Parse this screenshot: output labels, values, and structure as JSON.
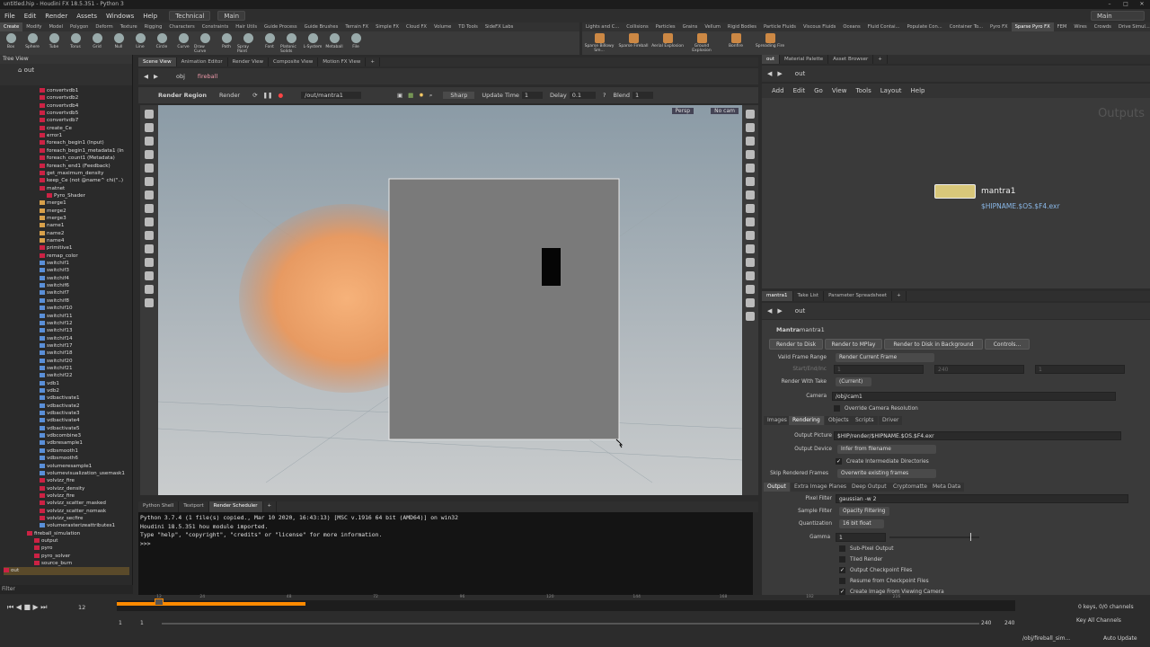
{
  "window": {
    "title": "untitled.hip - Houdini FX 18.5.351 - Python 3"
  },
  "menu": [
    "File",
    "Edit",
    "Render",
    "Assets",
    "Windows",
    "Help"
  ],
  "desktop": {
    "technical": "Technical",
    "main": "Main",
    "right_main": "Main"
  },
  "shelf_tabs": [
    "Create",
    "Modify",
    "Model",
    "Polygon",
    "Deform",
    "Texture",
    "Rigging",
    "Characters",
    "Constraints",
    "Hair Utils",
    "Guide Process",
    "Guide Brushes",
    "Terrain FX",
    "Simple FX",
    "Cloud FX",
    "Volume",
    "TD Tools",
    "SideFX Labs"
  ],
  "shelf_tools": [
    "Box",
    "Sphere",
    "Tube",
    "Torus",
    "Grid",
    "Null",
    "Line",
    "Circle",
    "Curve",
    "Draw Curve",
    "Path",
    "Spray Paint",
    "Font",
    "Platonic Solids",
    "L-System",
    "Metaball",
    "File"
  ],
  "shelf_tabs_right": [
    "Lights and C...",
    "Collisions",
    "Particles",
    "Grains",
    "Vellum",
    "Rigid Bodies",
    "Particle Fluids",
    "Viscous Fluids",
    "Oceans",
    "Fluid Contai...",
    "Populate Con...",
    "Container To...",
    "Pyro FX",
    "Sparse Pyro FX",
    "FEM",
    "Wires",
    "Crowds",
    "Drive Simul..."
  ],
  "shelf_tools_right": [
    "Sparse Billowy Sm...",
    "Sparse Fireball",
    "Aerial Explosion",
    "Ground Explosion",
    "Bonfire",
    "Spreading Fire"
  ],
  "tree": {
    "header": "Tree View",
    "path": "out",
    "filter": "Filter",
    "nodes": [
      "convertvdb1",
      "convertvdb2",
      "convertvdb4",
      "convertvdb5",
      "convertvdb7",
      "create_Ce",
      "error1",
      "foreach_begin1 (Input)",
      "foreach_begin1_metadata1 (In",
      "foreach_count1 (Metadata)",
      "foreach_end1 (Feedback)",
      "get_maximum_density",
      "keep_Ce (not @name^ chi(\"..)",
      "matnet",
      "Pyro_Shader",
      "merge1",
      "merge2",
      "merge3",
      "name1",
      "name2",
      "name4",
      "primitive1",
      "remap_color",
      "switchif1",
      "switchif3",
      "switchif4",
      "switchif6",
      "switchif7",
      "switchif8",
      "switchif10",
      "switchif11",
      "switchif12",
      "switchif13",
      "switchif14",
      "switchif17",
      "switchif18",
      "switchif20",
      "switchif21",
      "switchif22",
      "vdb1",
      "vdb2",
      "vdbactivate1",
      "vdbactivate2",
      "vdbactivate3",
      "vdbactivate4",
      "vdbactivate5",
      "vdbcombine3",
      "vdbresample1",
      "vdbsmooth1",
      "vdbsmooth6",
      "volumeresample1",
      "volumevisualization_usemask1",
      "volvizz_fire",
      "volvizz_density",
      "volvizz_fire",
      "volvizz_scatter_masked",
      "volvizz_scatter_nomask",
      "volvizz_secfire",
      "volumerasterizeattributes1",
      "fireball_simulation",
      "output",
      "pyro",
      "pyro_solver",
      "source_burn",
      "out"
    ]
  },
  "viewer": {
    "tabs": [
      "Scene View",
      "Animation Editor",
      "Render View",
      "Composite View",
      "Motion FX View"
    ],
    "path_obj": "obj",
    "path_node": "fireball",
    "render_region": "Render Region",
    "render": "Render",
    "rop_path": "/out/mantra1",
    "sharp": "Sharp",
    "update_time_label": "Update Time",
    "update_time": "1",
    "delay_label": "Delay",
    "delay": "0.1",
    "blend_label": "Blend",
    "blend": "1",
    "persp": "Persp",
    "cam": "No cam"
  },
  "console": {
    "tabs": [
      "Python Shell",
      "Textport",
      "Render Scheduler"
    ],
    "lines": [
      "Python 3.7.4 (1 file(s) copied., Mar 10 2020, 16:43:13) [MSC v.1916 64 bit (AMD64)] on win32",
      "Houdini 18.5.351 hou module imported.",
      "Type \"help\", \"copyright\", \"credits\" or \"license\" for more information.",
      ">>>"
    ]
  },
  "network": {
    "tabs": [
      "out",
      "Material Palette",
      "Asset Browser"
    ],
    "path": "out",
    "menu": [
      "Add",
      "Edit",
      "Go",
      "View",
      "Tools",
      "Layout",
      "Help"
    ],
    "watermark": "Outputs",
    "node_name": "mantra1",
    "node_output": "$HIPNAME.$OS.$F4.exr"
  },
  "params": {
    "tabs": [
      "mantra1",
      "Take List",
      "Parameter Spreadsheet"
    ],
    "path": "out",
    "type": "Mantra",
    "name": "mantra1",
    "buttons": [
      "Render to Disk",
      "Render to MPlay",
      "Render to Disk in Background",
      "Controls..."
    ],
    "valid_frame_range_label": "Valid Frame Range",
    "valid_frame_range": "Render Current Frame",
    "start_end_label": "Start/End/Inc",
    "start": "1",
    "end": "240",
    "inc": "1",
    "render_with_take_label": "Render With Take",
    "render_with_take": "(Current)",
    "camera_label": "Camera",
    "camera": "/obj/cam1",
    "override_cam": "Override Camera Resolution",
    "section_tabs": [
      "Images",
      "Rendering",
      "Objects",
      "Scripts",
      "Driver"
    ],
    "output_picture_label": "Output Picture",
    "output_picture": "$HIP/render/$HIPNAME.$OS.$F4.exr",
    "output_device_label": "Output Device",
    "output_device": "Infer from filename",
    "create_dirs": "Create Intermediate Directories",
    "skip_frames_label": "Skip Rendered Frames",
    "skip_frames": "Overwrite existing frames",
    "sub_tabs": [
      "Output",
      "Extra Image Planes",
      "Deep Output",
      "Cryptomatte",
      "Meta Data"
    ],
    "pixel_filter_label": "Pixel Filter",
    "pixel_filter": "gaussian -w 2",
    "sample_filter_label": "Sample Filter",
    "sample_filter": "Opacity Filtering",
    "quantization_label": "Quantization",
    "quantization": "16 bit float",
    "gamma_label": "Gamma",
    "gamma": "1",
    "checks": [
      "Sub-Pixel Output",
      "Tiled Render",
      "Output Checkpoint Files",
      "Resume from Checkpoint Files",
      "Create Image From Viewing Camera"
    ],
    "checked": [
      false,
      false,
      true,
      false,
      true
    ]
  },
  "timeline": {
    "frame": "12",
    "start": "1",
    "start2": "1",
    "end": "240",
    "end2": "240",
    "ticks": [
      "12",
      "24",
      "48",
      "72",
      "96",
      "120",
      "144",
      "168",
      "192",
      "216"
    ],
    "keys": "0 keys, 0/0 channels",
    "key_all": "Key All Channels",
    "auto_update": "Auto Update",
    "status_path": "/obj/fireball_sim..."
  },
  "colors": {
    "accent": "#ff8a00",
    "viewport_bg": "#a8b3ba"
  }
}
